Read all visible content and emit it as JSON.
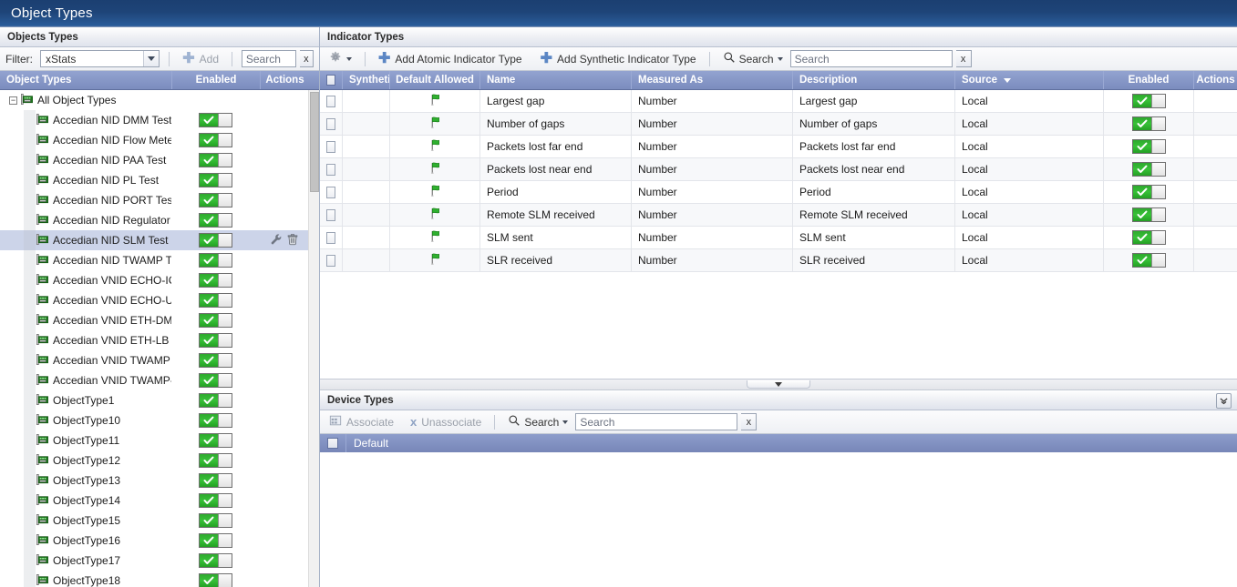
{
  "window": {
    "title": "Object Types"
  },
  "object_types_panel": {
    "header": "Objects Types",
    "toolbar": {
      "filter_label": "Filter:",
      "filter_value": "xStats",
      "add_label": "Add",
      "search_placeholder": "Search",
      "search_value": "",
      "clear_label": "x"
    },
    "columns": [
      "Object Types",
      "Enabled",
      "Actions"
    ],
    "root": {
      "label": "All Object Types",
      "icon": "network-card-icon",
      "expander": "minus"
    },
    "items": [
      {
        "label": "Accedian NID DMM Test",
        "enabled": true,
        "selected": false
      },
      {
        "label": "Accedian NID Flow Meter ...",
        "enabled": true,
        "selected": false
      },
      {
        "label": "Accedian NID PAA Test",
        "enabled": true,
        "selected": false
      },
      {
        "label": "Accedian NID PL Test",
        "enabled": true,
        "selected": false
      },
      {
        "label": "Accedian NID PORT Test",
        "enabled": true,
        "selected": false
      },
      {
        "label": "Accedian NID Regulator Test",
        "enabled": true,
        "selected": false
      },
      {
        "label": "Accedian NID SLM Test",
        "enabled": true,
        "selected": true
      },
      {
        "label": "Accedian NID TWAMP Test",
        "enabled": true,
        "selected": false
      },
      {
        "label": "Accedian VNID ECHO-ICM...",
        "enabled": true,
        "selected": false
      },
      {
        "label": "Accedian VNID ECHO-UDP...",
        "enabled": true,
        "selected": false
      },
      {
        "label": "Accedian VNID ETH-DM Test",
        "enabled": true,
        "selected": false
      },
      {
        "label": "Accedian VNID ETH-LB Test",
        "enabled": true,
        "selected": false
      },
      {
        "label": "Accedian VNID TWAMP Test",
        "enabled": true,
        "selected": false
      },
      {
        "label": "Accedian VNID TWAMP-SL...",
        "enabled": true,
        "selected": false
      },
      {
        "label": "ObjectType1",
        "enabled": true,
        "selected": false
      },
      {
        "label": "ObjectType10",
        "enabled": true,
        "selected": false
      },
      {
        "label": "ObjectType11",
        "enabled": true,
        "selected": false
      },
      {
        "label": "ObjectType12",
        "enabled": true,
        "selected": false
      },
      {
        "label": "ObjectType13",
        "enabled": true,
        "selected": false
      },
      {
        "label": "ObjectType14",
        "enabled": true,
        "selected": false
      },
      {
        "label": "ObjectType15",
        "enabled": true,
        "selected": false
      },
      {
        "label": "ObjectType16",
        "enabled": true,
        "selected": false
      },
      {
        "label": "ObjectType17",
        "enabled": true,
        "selected": false
      },
      {
        "label": "ObjectType18",
        "enabled": true,
        "selected": false
      }
    ],
    "row_actions": {
      "edit": "wrench-icon",
      "delete": "trash-icon"
    }
  },
  "indicator_types_panel": {
    "header": "Indicator Types",
    "toolbar": {
      "gear_label": "gear-icon",
      "add_atomic_label": "Add Atomic Indicator Type",
      "add_synthetic_label": "Add Synthetic Indicator Type",
      "search_drop_label": "Search",
      "search_placeholder": "Search",
      "search_value": "",
      "clear_label": "x"
    },
    "columns": [
      {
        "label": "",
        "key": "check"
      },
      {
        "label": "Synthetic",
        "key": "synthetic"
      },
      {
        "label": "Default Allowed",
        "key": "default_allowed"
      },
      {
        "label": "Name",
        "key": "name"
      },
      {
        "label": "Measured As",
        "key": "measured_as"
      },
      {
        "label": "Description",
        "key": "description"
      },
      {
        "label": "Source",
        "key": "source",
        "sorted": "desc"
      },
      {
        "label": "Enabled",
        "key": "enabled"
      },
      {
        "label": "Actions",
        "key": "actions"
      }
    ],
    "rows": [
      {
        "synthetic": "",
        "default_allowed": true,
        "name": "Largest gap",
        "measured_as": "Number",
        "description": "Largest gap",
        "source": "Local",
        "enabled": true
      },
      {
        "synthetic": "",
        "default_allowed": true,
        "name": "Number of gaps",
        "measured_as": "Number",
        "description": "Number of gaps",
        "source": "Local",
        "enabled": true
      },
      {
        "synthetic": "",
        "default_allowed": true,
        "name": "Packets lost far end",
        "measured_as": "Number",
        "description": "Packets lost far end",
        "source": "Local",
        "enabled": true
      },
      {
        "synthetic": "",
        "default_allowed": true,
        "name": "Packets lost near end",
        "measured_as": "Number",
        "description": "Packets lost near end",
        "source": "Local",
        "enabled": true
      },
      {
        "synthetic": "",
        "default_allowed": true,
        "name": "Period",
        "measured_as": "Number",
        "description": "Period",
        "source": "Local",
        "enabled": true
      },
      {
        "synthetic": "",
        "default_allowed": true,
        "name": "Remote SLM received",
        "measured_as": "Number",
        "description": "Remote SLM received",
        "source": "Local",
        "enabled": true
      },
      {
        "synthetic": "",
        "default_allowed": true,
        "name": "SLM sent",
        "measured_as": "Number",
        "description": "SLM sent",
        "source": "Local",
        "enabled": true
      },
      {
        "synthetic": "",
        "default_allowed": true,
        "name": "SLR received",
        "measured_as": "Number",
        "description": "SLR received",
        "source": "Local",
        "enabled": true
      }
    ]
  },
  "device_types_panel": {
    "header": "Device Types",
    "collapse_icon": "double-chevron-down-icon",
    "toolbar": {
      "associate_label": "Associate",
      "unassociate_label": "Unassociate",
      "search_drop_label": "Search",
      "search_placeholder": "Search",
      "search_value": "",
      "clear_label": "x"
    },
    "rows": [
      {
        "label": "Default",
        "selected": true
      }
    ]
  },
  "colors": {
    "titlebar_from": "#1b3f71",
    "titlebar_to": "#2b5d9b",
    "grid_header": "#7b8cbe",
    "selection": "#ccd4e9",
    "toggle_on": "#37c137",
    "accent_blue": "#5b86c4"
  }
}
